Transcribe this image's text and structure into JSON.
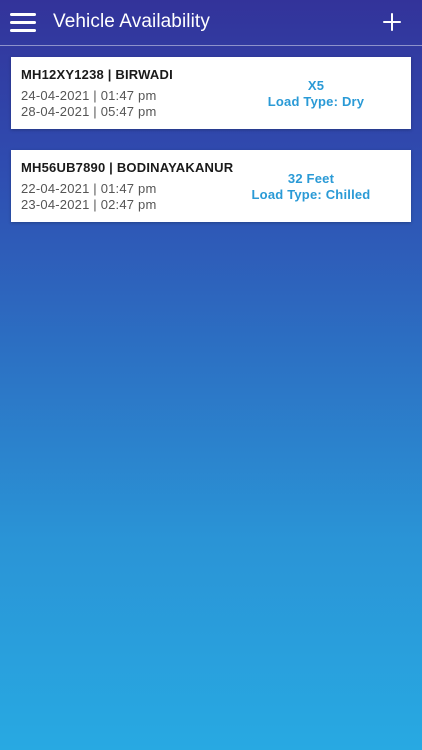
{
  "header": {
    "title": "Vehicle Availability"
  },
  "vehicles": [
    {
      "heading": "MH12XY1238 | BIRWADI",
      "from": "24-04-2021 | 01:47 pm",
      "to": "28-04-2021 | 05:47 pm",
      "size": "X5",
      "load_type": "Load Type: Dry"
    },
    {
      "heading": "MH56UB7890 | BODINAYAKANUR",
      "from": "22-04-2021 | 01:47 pm",
      "to": "23-04-2021 | 02:47 pm",
      "size": "32 Feet",
      "load_type": "Load Type: Chilled"
    }
  ],
  "colors": {
    "header_bg_top": "#33339a",
    "gradient_bottom": "#28a9e2",
    "accent_text": "#2a9ad6",
    "card_bg": "#ffffff"
  },
  "icons": {
    "menu": "hamburger-menu-icon",
    "add": "plus-icon"
  }
}
